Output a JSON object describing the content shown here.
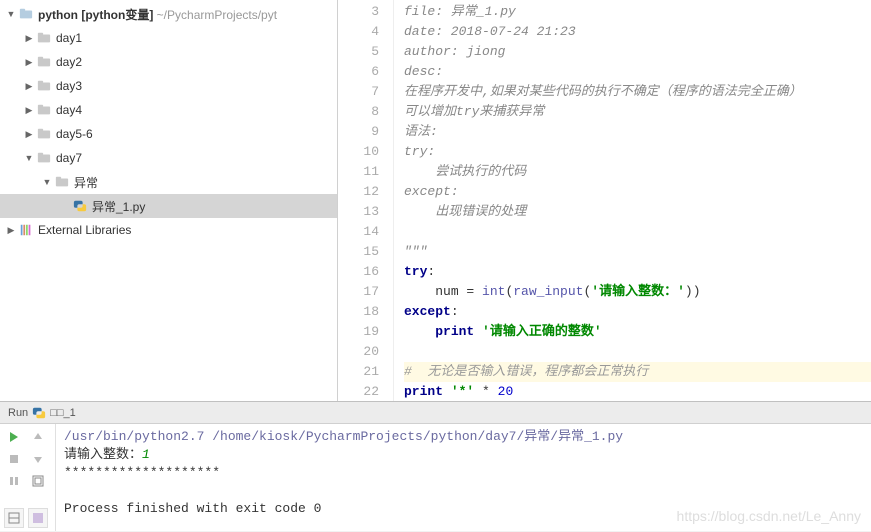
{
  "project": {
    "root": {
      "name": "python",
      "suffix": "[python变量]",
      "path": "~/PycharmProjects/pyt"
    },
    "folders": [
      "day1",
      "day2",
      "day3",
      "day4",
      "day5-6"
    ],
    "day7": {
      "name": "day7",
      "sub": "异常",
      "file": "异常_1.py"
    },
    "external": "External Libraries"
  },
  "editor": {
    "gutter_start": 3,
    "gutter_end": 22,
    "lines": {
      "l3": "file: 异常_1.py",
      "l4": "date: 2018-07-24 21:23",
      "l5": "author: jiong",
      "l6": "desc:",
      "l7": "在程序开发中,如果对某些代码的执行不确定（程序的语法完全正确）",
      "l8": "可以增加try来捕获异常",
      "l9": "语法:",
      "l10": "try:",
      "l11": "    尝试执行的代码",
      "l12": "except:",
      "l13": "    出现错误的处理",
      "l15": "\"\"\"",
      "l16_try": "try",
      "l17_num": "num",
      "l17_eq": " = ",
      "l17_int": "int",
      "l17_raw": "raw_input",
      "l17_str": "'请输入整数：'",
      "l18_except": "except",
      "l19_print": "print",
      "l19_str": "'请输入正确的整数'",
      "l21": "#  无论是否输入错误，程序都会正常执行",
      "l22_print": "print",
      "l22_str": "'*'",
      "l22_mul": " * ",
      "l22_num": "20"
    }
  },
  "run": {
    "label": "Run",
    "config": "□□_1",
    "cmd": "/usr/bin/python2.7 /home/kiosk/PycharmProjects/python/day7/异常/异常_1.py",
    "prompt": "请输入整数：",
    "input": "1",
    "stars": "********************",
    "exit": "Process finished with exit code 0"
  },
  "watermark": "https://blog.csdn.net/Le_Anny"
}
